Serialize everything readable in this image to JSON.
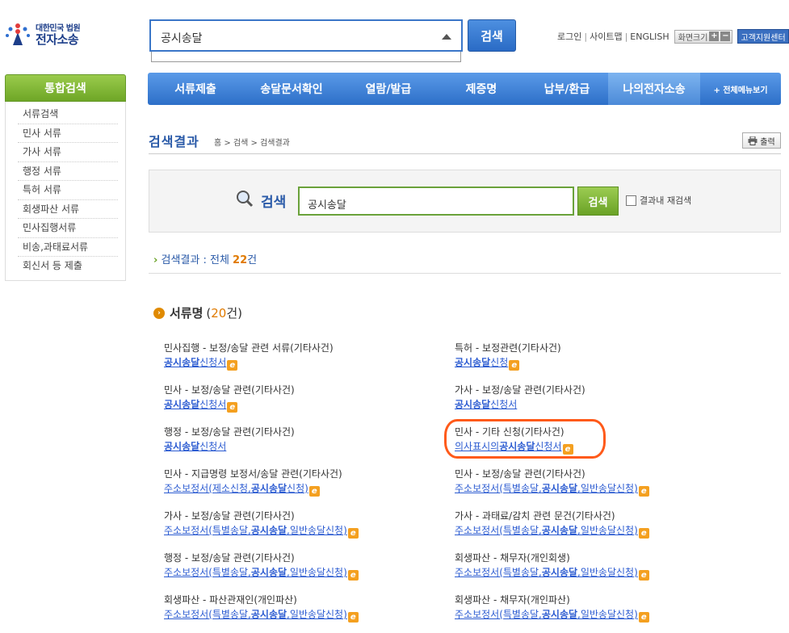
{
  "logo": {
    "small": "대한민국 법원",
    "big": "전자소송"
  },
  "top_search": {
    "value": "공시송달",
    "button": "검색"
  },
  "util": {
    "login": "로그인",
    "sitemap": "사이트맵",
    "english": "ENGLISH",
    "font_size": "화면크기",
    "plus": "+",
    "minus": "−",
    "help": "고객지원센터"
  },
  "sidebar": {
    "title": "통합검색",
    "items": [
      {
        "label": "서류검색"
      },
      {
        "label": "민사 서류"
      },
      {
        "label": "가사 서류"
      },
      {
        "label": "행정 서류"
      },
      {
        "label": "특허 서류"
      },
      {
        "label": "회생파산 서류"
      },
      {
        "label": "민사집행서류"
      },
      {
        "label": "비송,과태료서류"
      },
      {
        "label": "회신서 등 제출"
      }
    ]
  },
  "mainnav": {
    "items": [
      {
        "label": "서류제출"
      },
      {
        "label": "송달문서확인"
      },
      {
        "label": "열람/발급"
      },
      {
        "label": "제증명"
      },
      {
        "label": "납부/환급"
      },
      {
        "label": "나의전자소송"
      }
    ],
    "more": "+ 전체메뉴보기"
  },
  "page": {
    "title": "검색결과",
    "breadcrumb": "홈 > 검색 > 검색결과",
    "print": "출력"
  },
  "search_panel": {
    "label": "검색",
    "value": "공시송달",
    "button": "검색",
    "recheck": "결과내 재검색"
  },
  "summary": {
    "prefix": "검색결과 : 전체 ",
    "count": "22",
    "suffix": "건"
  },
  "section": {
    "title": "서류명",
    "open": "(",
    "count": "20",
    "close": "건)"
  },
  "results": [
    {
      "cat": "민사집행 - 보정/송달 관련 서류(기타사건)",
      "links": [
        {
          "pre": "",
          "bold": "공시송달",
          "post": "신청서"
        }
      ],
      "e": true
    },
    {
      "cat": "특허 - 보정관련(기타사건)",
      "links": [
        {
          "pre": "",
          "bold": "공시송달",
          "post": "신청"
        }
      ],
      "e": true
    },
    {
      "cat": "민사 - 보정/송달 관련(기타사건)",
      "links": [
        {
          "pre": "",
          "bold": "공시송달",
          "post": "신청서"
        }
      ],
      "e": true
    },
    {
      "cat": "가사 - 보정/송달 관련(기타사건)",
      "links": [
        {
          "pre": "",
          "bold": "공시송달",
          "post": "신청서"
        }
      ],
      "e": false
    },
    {
      "cat": "행정 - 보정/송달 관련(기타사건)",
      "links": [
        {
          "pre": "",
          "bold": "공시송달",
          "post": "신청서"
        }
      ],
      "e": false
    },
    {
      "cat": "민사 - 기타 신청(기타사건)",
      "links": [
        {
          "pre": "의사표시의",
          "bold": "공시송달",
          "post": "신청서"
        }
      ],
      "e": true
    },
    {
      "cat": "민사 - 지급명령 보정서/송달 관련(기타사건)",
      "links": [
        {
          "pre": "주소보정서(제소신청,",
          "bold": "공시송달",
          "post": "신청)"
        }
      ],
      "e": true
    },
    {
      "cat": "민사 - 보정/송달 관련(기타사건)",
      "links": [
        {
          "pre": "주소보정서(특별송달,",
          "bold": "공시송달",
          "post": ",일반송달신청)"
        }
      ],
      "e": true
    },
    {
      "cat": "가사 - 보정/송달 관련(기타사건)",
      "links": [
        {
          "pre": "주소보정서(특별송달,",
          "bold": "공시송달",
          "post": ",일반송달신청)"
        }
      ],
      "e": true
    },
    {
      "cat": "가사 - 과태료/감치 관련 문건(기타사건)",
      "links": [
        {
          "pre": "주소보정서(특별송달,",
          "bold": "공시송달",
          "post": ",일반송달신청)"
        }
      ],
      "e": true
    },
    {
      "cat": "행정 - 보정/송달 관련(기타사건)",
      "links": [
        {
          "pre": "주소보정서(특별송달,",
          "bold": "공시송달",
          "post": ",일반송달신청)"
        }
      ],
      "e": true
    },
    {
      "cat": "회생파산 - 채무자(개인회생)",
      "links": [
        {
          "pre": "주소보정서(특별송달,",
          "bold": "공시송달",
          "post": ",일반송달신청)"
        }
      ],
      "e": true
    },
    {
      "cat": "회생파산 - 파산관재인(개인파산)",
      "links": [
        {
          "pre": "주소보정서(특별송달,",
          "bold": "공시송달",
          "post": ",일반송달신청)"
        }
      ],
      "e": true
    },
    {
      "cat": "회생파산 - 채무자(개인파산)",
      "links": [
        {
          "pre": "주소보정서(특별송달,",
          "bold": "공시송달",
          "post": ",일반송달신청)"
        }
      ],
      "e": true
    }
  ],
  "icons": {
    "e_icon": "e"
  },
  "colors": {
    "accent_blue": "#2d6fc8",
    "accent_green": "#6aa226",
    "highlight": "#ff5a1a",
    "count_orange": "#e07a00"
  }
}
